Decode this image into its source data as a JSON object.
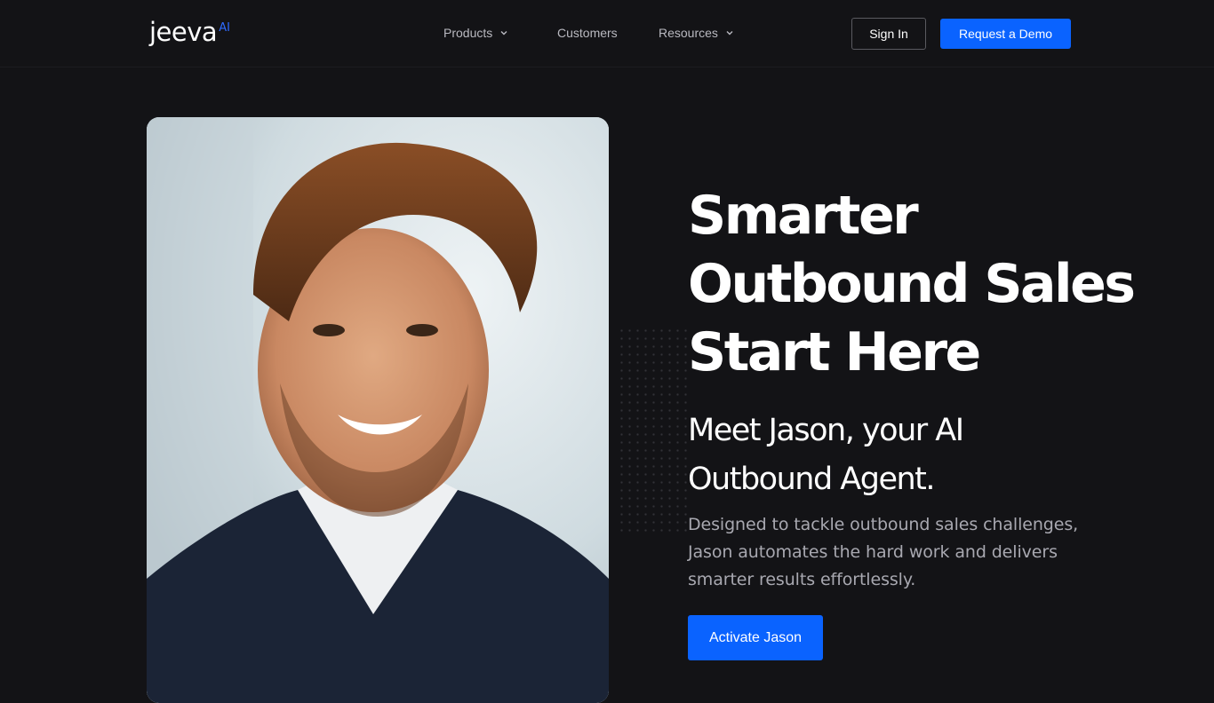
{
  "brand": {
    "logo_word": "jeeva",
    "logo_suffix": "AI",
    "accent_color": "#0a63ff"
  },
  "nav": {
    "items": [
      {
        "label": "Products",
        "has_dropdown": true
      },
      {
        "label": "Customers",
        "has_dropdown": false
      },
      {
        "label": "Resources",
        "has_dropdown": true
      }
    ],
    "sign_in_label": "Sign In",
    "demo_label": "Request a Demo"
  },
  "hero": {
    "headline_line1": "Smarter",
    "headline_line2": "Outbound Sales",
    "headline_line3": "Start Here",
    "subhead_line1": "Meet Jason, your AI",
    "subhead_line2": "Outbound Agent.",
    "description": "Designed to tackle outbound sales challenges, Jason automates the hard work and delivers smarter results effortlessly.",
    "cta_label": "Activate Jason",
    "photo_subject": "smiling man in suit portrait"
  }
}
